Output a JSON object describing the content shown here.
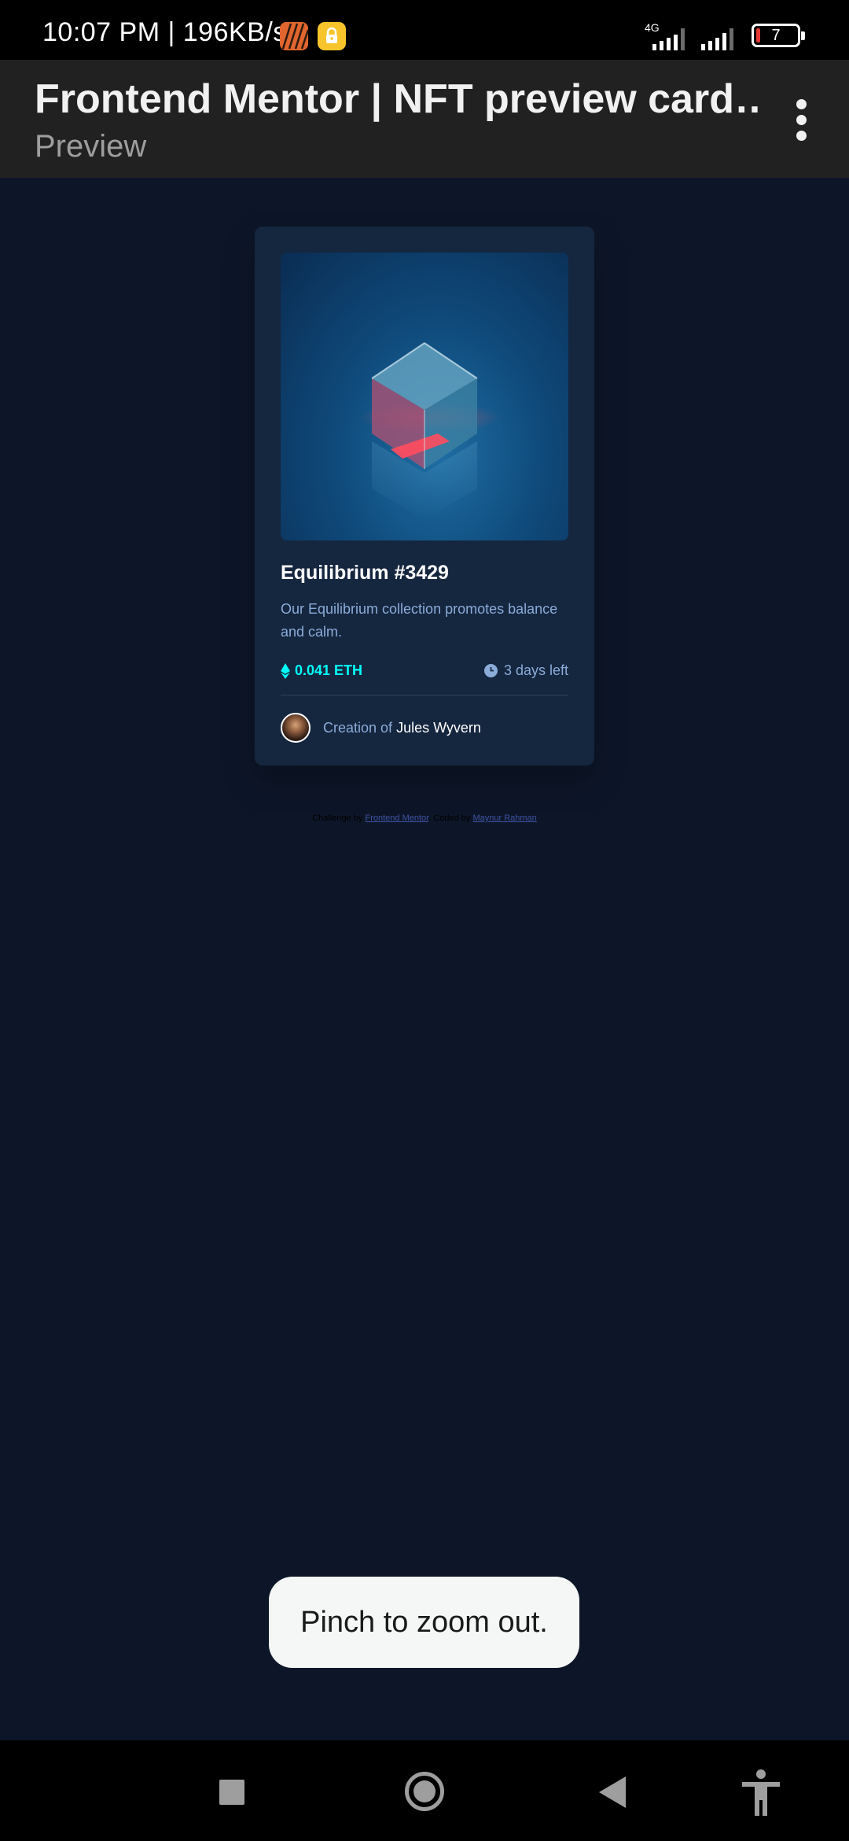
{
  "status_bar": {
    "time_speed": "10:07 PM | 196KB/s",
    "network_label": "4G",
    "battery_level": "7"
  },
  "app_bar": {
    "title": "Frontend Mentor | NFT preview card…",
    "subtitle": "Preview"
  },
  "card": {
    "title": "Equilibrium #3429",
    "description": "Our Equilibrium collection promotes balance and calm.",
    "price": "0.041 ETH",
    "time_left": "3 days left",
    "creator_prefix": "Creation of",
    "creator_name": "Jules Wyvern"
  },
  "attribution": {
    "prefix": "Challenge by",
    "link1": "Frontend Mentor",
    "middle": ". Coded by",
    "link2": "Maynur Rahman"
  },
  "toast": {
    "message": "Pinch to zoom out."
  },
  "colors": {
    "page_bg": "#0d1628",
    "card_bg": "#15263f",
    "cyan": "#00fff8",
    "soft_blue": "#8bacd9"
  }
}
